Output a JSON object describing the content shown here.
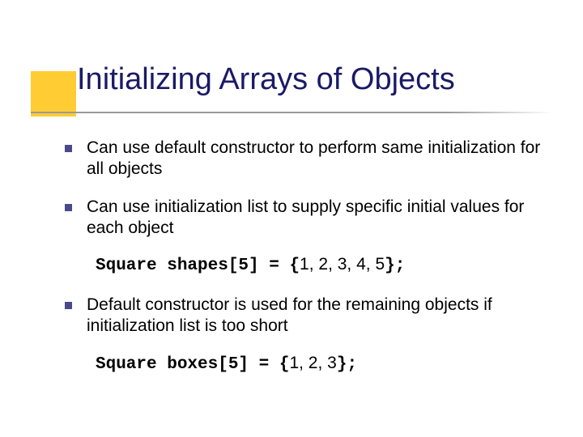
{
  "title": "Initializing Arrays of Objects",
  "bullets": [
    {
      "text": "Can use default constructor to perform same initialization for all objects"
    },
    {
      "text": "Can use initialization list to supply specific initial values for each object"
    },
    {
      "text": "Default constructor is used for the remaining objects if initialization list is too short"
    }
  ],
  "code": [
    {
      "prefix": "Square shapes[5] = {",
      "args": "1, 2, 3, 4, 5",
      "suffix": "};"
    },
    {
      "prefix": "Square boxes[5] = {",
      "args": "1, 2, 3",
      "suffix": "};"
    }
  ]
}
